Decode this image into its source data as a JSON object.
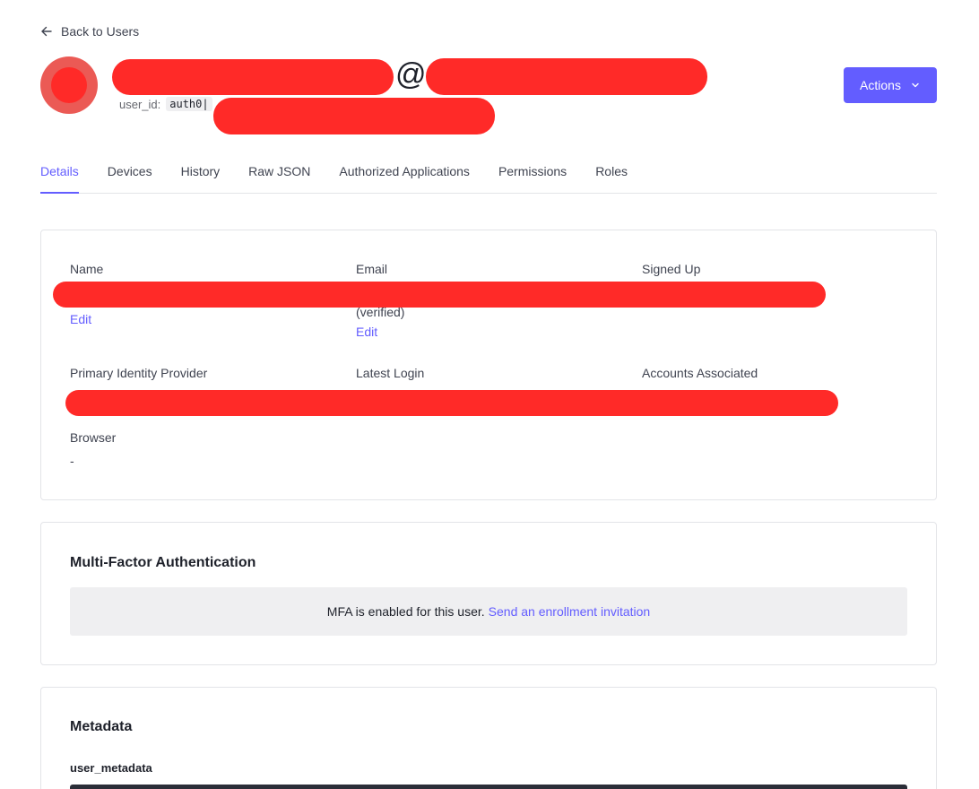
{
  "nav": {
    "back_label": "Back to Users"
  },
  "header": {
    "email_at": "@",
    "user_id_label": "user_id:",
    "user_id_value": "auth0|",
    "actions_label": "Actions"
  },
  "tabs": [
    {
      "label": "Details",
      "active": true
    },
    {
      "label": "Devices"
    },
    {
      "label": "History"
    },
    {
      "label": "Raw JSON"
    },
    {
      "label": "Authorized Applications"
    },
    {
      "label": "Permissions"
    },
    {
      "label": "Roles"
    }
  ],
  "details": {
    "name_label": "Name",
    "email_label": "Email",
    "signed_up_label": "Signed Up",
    "edit_label": "Edit",
    "verified_text": "(verified)",
    "primary_idp_label": "Primary Identity Provider",
    "latest_login_label": "Latest Login",
    "accounts_associated_label": "Accounts Associated",
    "browser_label": "Browser",
    "browser_value": "-"
  },
  "mfa": {
    "title": "Multi-Factor Authentication",
    "status_text": "MFA is enabled for this user.",
    "invite_link": "Send an enrollment invitation"
  },
  "metadata": {
    "title": "Metadata",
    "user_metadata_label": "user_metadata"
  },
  "colors": {
    "accent": "#635dff",
    "redaction": "#ff2a28",
    "avatar": "#eb5a55"
  }
}
